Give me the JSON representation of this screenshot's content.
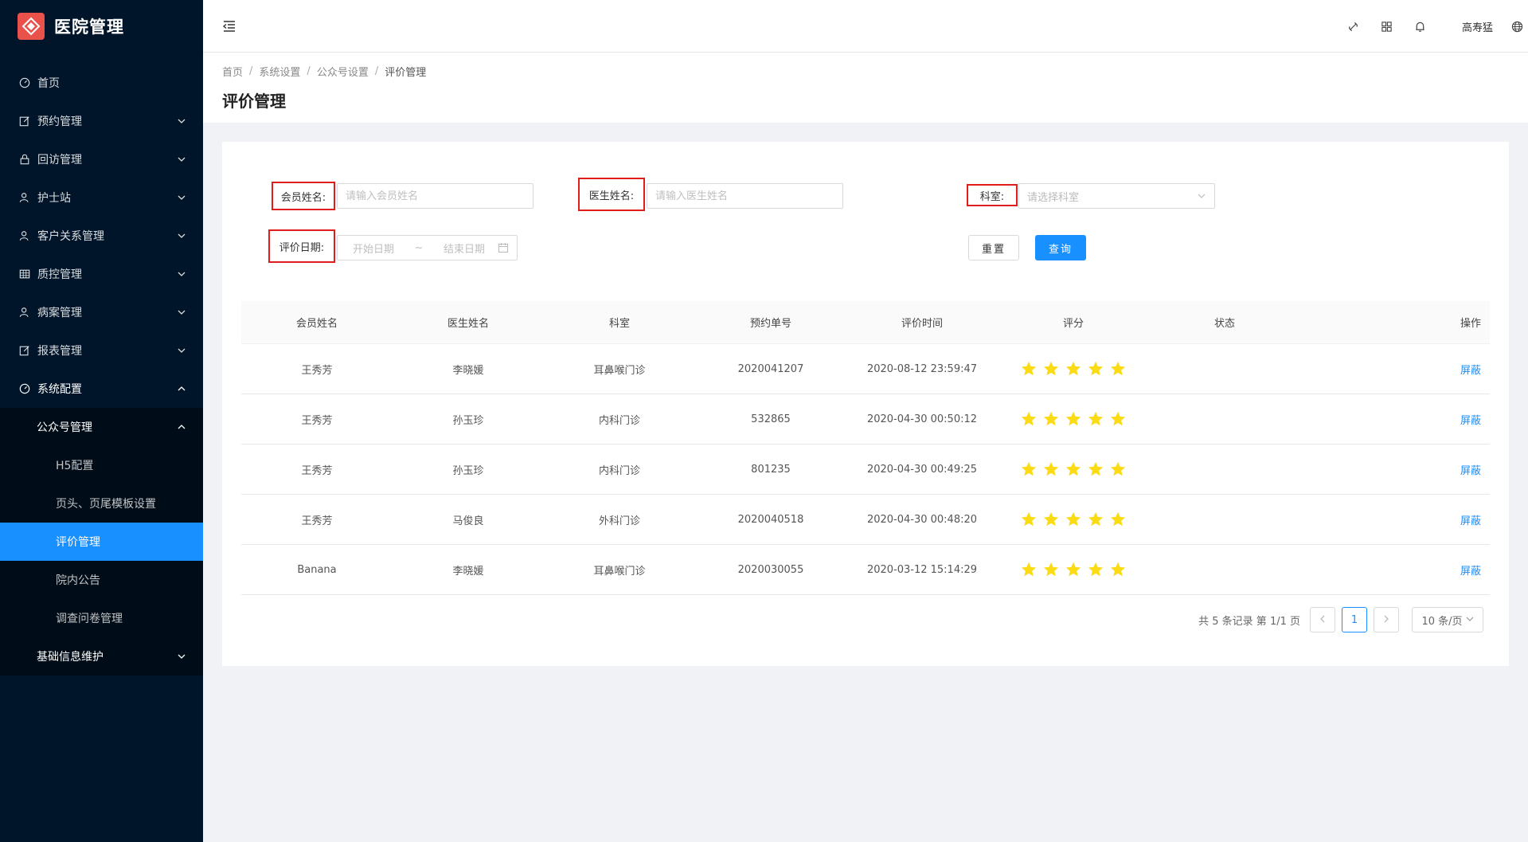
{
  "app": {
    "title": "医院管理"
  },
  "sidebar": {
    "items": [
      {
        "label": "首页",
        "icon": "dashboard-icon"
      },
      {
        "label": "预约管理",
        "icon": "edit-icon"
      },
      {
        "label": "回访管理",
        "icon": "lock-icon"
      },
      {
        "label": "护士站",
        "icon": "user-icon"
      },
      {
        "label": "客户关系管理",
        "icon": "user-icon"
      },
      {
        "label": "质控管理",
        "icon": "table-icon"
      },
      {
        "label": "病案管理",
        "icon": "user-icon"
      },
      {
        "label": "报表管理",
        "icon": "edit-icon"
      },
      {
        "label": "系统配置",
        "icon": "dashboard-icon"
      }
    ],
    "sub_group": {
      "label": "公众号管理"
    },
    "sub_items": [
      {
        "label": "H5配置"
      },
      {
        "label": "页头、页尾模板设置"
      },
      {
        "label": "评价管理",
        "active": true
      },
      {
        "label": "院内公告"
      },
      {
        "label": "调查问卷管理"
      }
    ],
    "last_group": {
      "label": "基础信息维护"
    }
  },
  "header": {
    "user": "高寿猛"
  },
  "breadcrumb": [
    "首页",
    "系统设置",
    "公众号设置",
    "评价管理"
  ],
  "page": {
    "title": "评价管理"
  },
  "filters": {
    "member_label": "会员姓名:",
    "member_placeholder": "请输入会员姓名",
    "doctor_label": "医生姓名:",
    "doctor_placeholder": "请输入医生姓名",
    "dept_label": "科室:",
    "dept_placeholder": "请选择科室",
    "date_label": "评价日期:",
    "date_start": "开始日期",
    "date_sep": "~",
    "date_end": "结束日期",
    "reset": "重置",
    "query": "查询"
  },
  "table": {
    "columns": [
      "会员姓名",
      "医生姓名",
      "科室",
      "预约单号",
      "评价时间",
      "评分",
      "状态",
      "操作"
    ],
    "rows": [
      {
        "member": "王秀芳",
        "doctor": "李晓媛",
        "dept": "耳鼻喉门诊",
        "order": "2020041207",
        "time": "2020-08-12 23:59:47",
        "rating": 5,
        "status": "",
        "action": "屏蔽"
      },
      {
        "member": "王秀芳",
        "doctor": "孙玉珍",
        "dept": "内科门诊",
        "order": "532865",
        "time": "2020-04-30 00:50:12",
        "rating": 5,
        "status": "",
        "action": "屏蔽"
      },
      {
        "member": "王秀芳",
        "doctor": "孙玉珍",
        "dept": "内科门诊",
        "order": "801235",
        "time": "2020-04-30 00:49:25",
        "rating": 5,
        "status": "",
        "action": "屏蔽"
      },
      {
        "member": "王秀芳",
        "doctor": "马俊良",
        "dept": "外科门诊",
        "order": "2020040518",
        "time": "2020-04-30 00:48:20",
        "rating": 5,
        "status": "",
        "action": "屏蔽"
      },
      {
        "member": "Banana",
        "doctor": "李晓媛",
        "dept": "耳鼻喉门诊",
        "order": "2020030055",
        "time": "2020-03-12 15:14:29",
        "rating": 5,
        "status": "",
        "action": "屏蔽"
      }
    ]
  },
  "pagination": {
    "total_text": "共 5 条记录 第 1/1 页",
    "current": "1",
    "page_size": "10 条/页"
  },
  "colors": {
    "primary": "#1890ff",
    "sidebar": "#001529",
    "star": "#fadb14",
    "highlight": "#e01d1d",
    "logo": "#e8524a"
  }
}
